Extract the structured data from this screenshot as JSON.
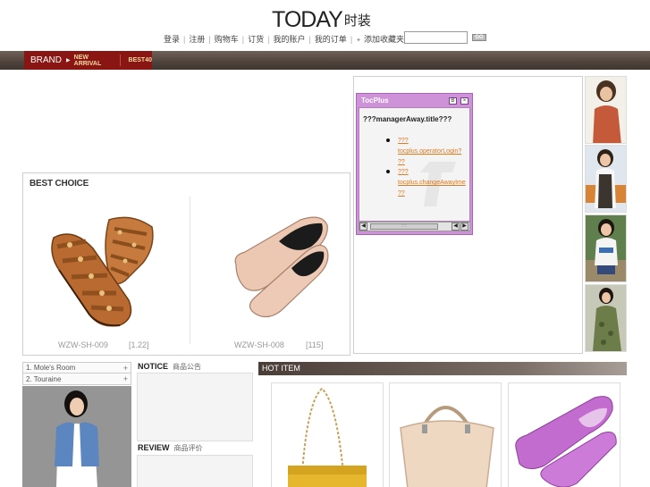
{
  "header": {
    "logo_text": "TODAY",
    "logo_cn": "时装",
    "nav": [
      "登录",
      "注册",
      "购物车",
      "订货",
      "我的账户",
      "我的订单",
      "添加收藏夹"
    ],
    "search_placeholder": "",
    "go_label": "GO"
  },
  "brand_bar": {
    "brand": "BRAND",
    "new_arrival": "NEW ARRIVAL",
    "best40": "BEST40"
  },
  "best_choice": {
    "title": "BEST CHOICE",
    "products": [
      {
        "code": "WZW-SH-009",
        "price": "[1.22]"
      },
      {
        "code": "WZW-SH-008",
        "price": "[115]"
      }
    ]
  },
  "tocplus": {
    "title": "TocPlus",
    "min_label": "B",
    "close_label": "×",
    "heading": "???managerAway.title???",
    "links": [
      {
        "line1": "???",
        "line2": "tocplus.operatorLogin?",
        "line3": "??"
      },
      {
        "line1": "???",
        "line2": "tocplus.changeAwayIme",
        "line3": "??"
      }
    ],
    "scroll_grip": ":::::"
  },
  "left_list": {
    "items": [
      "1. Mole's Room",
      "2. Touraine"
    ],
    "expand_symbol": "+"
  },
  "notice": {
    "title": "NOTICE",
    "title_cn": "商品公告"
  },
  "review": {
    "title": "REVIEW",
    "title_cn": "商品评价"
  },
  "hot_item": {
    "title": "HOT ITEM"
  },
  "colors": {
    "brand_red": "#8a1613",
    "tocplus_purple": "#ce92d8",
    "link_orange": "#e07a1a"
  }
}
